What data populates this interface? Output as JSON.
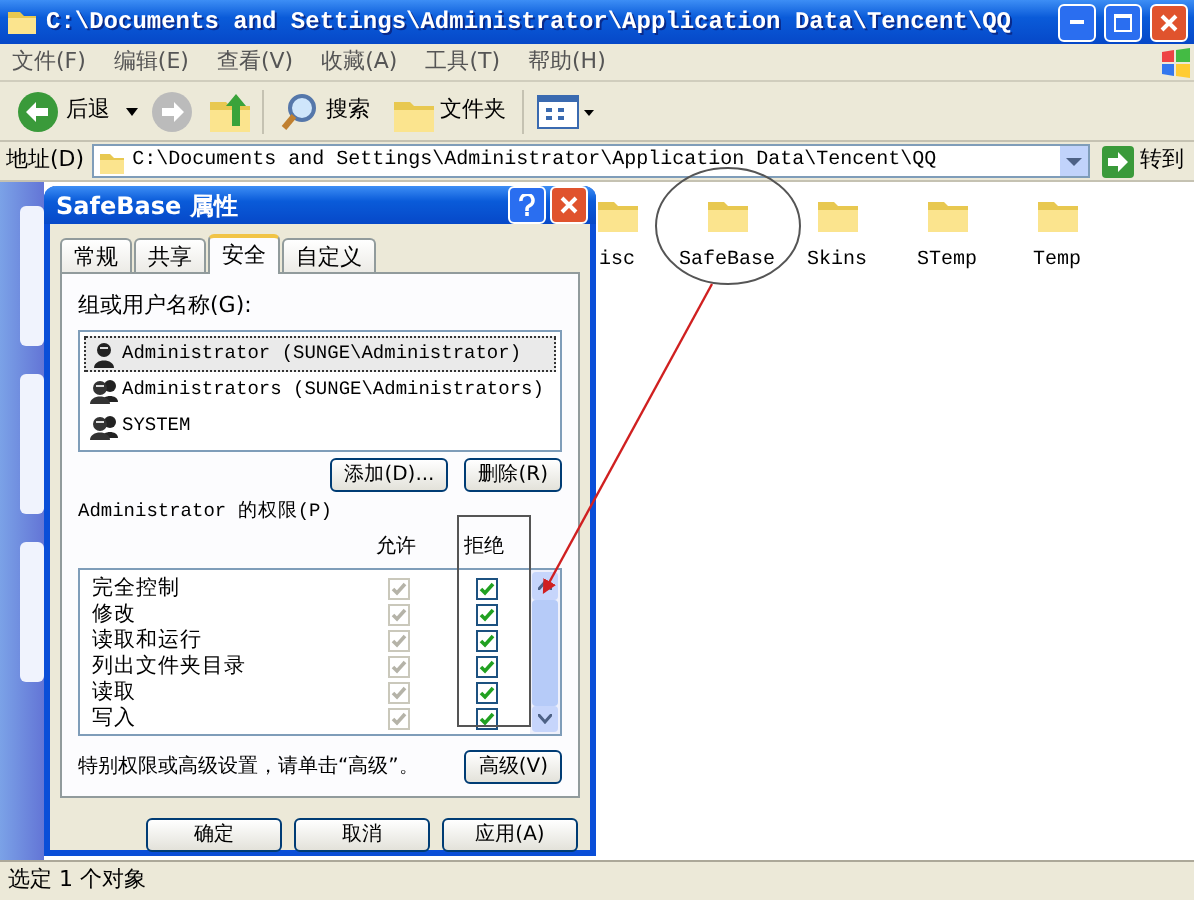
{
  "window": {
    "title": "C:\\Documents and Settings\\Administrator\\Application Data\\Tencent\\QQ"
  },
  "menu": [
    "文件(F)",
    "编辑(E)",
    "查看(V)",
    "收藏(A)",
    "工具(T)",
    "帮助(H)"
  ],
  "toolbar": {
    "back": "后退",
    "search": "搜索",
    "folders": "文件夹"
  },
  "address": {
    "label": "地址(D)",
    "value": "C:\\Documents and Settings\\Administrator\\Application Data\\Tencent\\QQ",
    "go": "转到"
  },
  "folders": [
    {
      "name": "isc"
    },
    {
      "name": "SafeBase"
    },
    {
      "name": "Skins"
    },
    {
      "name": "STemp"
    },
    {
      "name": "Temp"
    }
  ],
  "dialog": {
    "title": "SafeBase 属性",
    "tabs": [
      {
        "label": "常规",
        "selected": false
      },
      {
        "label": "共享",
        "selected": false
      },
      {
        "label": "安全",
        "selected": true
      },
      {
        "label": "自定义",
        "selected": false
      }
    ],
    "users_label": "组或用户名称(G):",
    "users": [
      {
        "name": "Administrator (SUNGE\\Administrator)",
        "kind": "user",
        "selected": true
      },
      {
        "name": "Administrators (SUNGE\\Administrators)",
        "kind": "group",
        "selected": false
      },
      {
        "name": "SYSTEM",
        "kind": "group",
        "selected": false
      }
    ],
    "add_button": "添加(D)...",
    "remove_button": "删除(R)",
    "permissions_label": "Administrator 的权限(P)",
    "columns": [
      "允许",
      "拒绝"
    ],
    "permissions": [
      {
        "name": "完全控制",
        "allow": true,
        "deny": true
      },
      {
        "name": "修改",
        "allow": true,
        "deny": true
      },
      {
        "name": "读取和运行",
        "allow": true,
        "deny": true
      },
      {
        "name": "列出文件夹目录",
        "allow": true,
        "deny": true
      },
      {
        "name": "读取",
        "allow": true,
        "deny": true
      },
      {
        "name": "写入",
        "allow": true,
        "deny": true
      }
    ],
    "allow_disabled": true,
    "advanced_note": "特别权限或高级设置，请单击“高级”。",
    "advanced_button": "高级(V)",
    "buttons": [
      "确定",
      "取消",
      "应用(A)"
    ]
  },
  "status_bar": "选定 1 个对象"
}
